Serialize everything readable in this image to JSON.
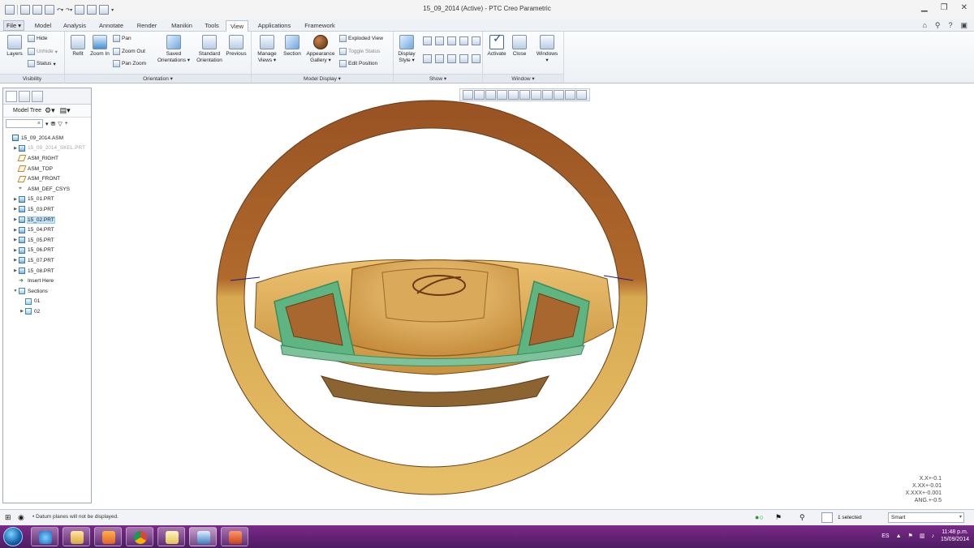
{
  "window": {
    "title": "15_09_2014 (Active) - PTC Creo Parametric"
  },
  "ribbon_tabs": [
    {
      "label": "File ▾"
    },
    {
      "label": "Model"
    },
    {
      "label": "Analysis"
    },
    {
      "label": "Annotate"
    },
    {
      "label": "Render"
    },
    {
      "label": "Manikin"
    },
    {
      "label": "Tools"
    },
    {
      "label": "View"
    },
    {
      "label": "Applications"
    },
    {
      "label": "Framework"
    }
  ],
  "groups": {
    "visibility": {
      "label": "Visibility",
      "layers": "Layers",
      "hide": "Hide",
      "unhide": "Unhide",
      "status": "Status"
    },
    "orientation": {
      "label": "Orientation ▾",
      "refit": "Refit",
      "zoom_in": "Zoom In",
      "pan": "Pan",
      "zoom_out": "Zoom Out",
      "pan_zoom": "Pan Zoom",
      "saved_orientations_1": "Saved",
      "saved_orientations_2": "Orientations ▾",
      "standard_orientation_1": "Standard",
      "standard_orientation_2": "Orientation",
      "previous": "Previous"
    },
    "model_display": {
      "label": "Model Display ▾",
      "manage_views_1": "Manage",
      "manage_views_2": "Views ▾",
      "section": "Section",
      "appearance_gallery_1": "Appearance",
      "appearance_gallery_2": "Gallery ▾",
      "exploded_view": "Exploded View",
      "toggle_status": "Toggle Status",
      "edit_position": "Edit Position"
    },
    "show": {
      "label": "Show ▾",
      "display_style_1": "Display",
      "display_style_2": "Style ▾"
    },
    "window": {
      "label": "Window ▾",
      "activate": "Activate",
      "close": "Close",
      "windows_1": "Windows",
      "windows_2": "▾"
    }
  },
  "model_tree": {
    "header": "Model Tree",
    "search_clear": "×",
    "items": [
      {
        "label": "15_09_2014.ASM",
        "icon": "asm",
        "indent": 0,
        "expander": ""
      },
      {
        "label": "15_09_2014_SKEL.PRT",
        "icon": "prt",
        "indent": 1,
        "expander": "▶",
        "ghost": true
      },
      {
        "label": "ASM_RIGHT",
        "icon": "plane",
        "indent": 1,
        "expander": ""
      },
      {
        "label": "ASM_TOP",
        "icon": "plane",
        "indent": 1,
        "expander": ""
      },
      {
        "label": "ASM_FRONT",
        "icon": "plane",
        "indent": 1,
        "expander": ""
      },
      {
        "label": "ASM_DEF_CSYS",
        "icon": "csys",
        "indent": 1,
        "expander": ""
      },
      {
        "label": "15_01.PRT",
        "icon": "prt",
        "indent": 1,
        "expander": "▶"
      },
      {
        "label": "15_03.PRT",
        "icon": "prt",
        "indent": 1,
        "expander": "▶"
      },
      {
        "label": "15_02.PRT",
        "icon": "prt",
        "indent": 1,
        "expander": "▶",
        "selected": true
      },
      {
        "label": "15_04.PRT",
        "icon": "prt",
        "indent": 1,
        "expander": "▶"
      },
      {
        "label": "15_05.PRT",
        "icon": "prt",
        "indent": 1,
        "expander": "▶"
      },
      {
        "label": "15_06.PRT",
        "icon": "prt",
        "indent": 1,
        "expander": "▶"
      },
      {
        "label": "15_07.PRT",
        "icon": "prt",
        "indent": 1,
        "expander": "▶"
      },
      {
        "label": "15_08.PRT",
        "icon": "prt",
        "indent": 1,
        "expander": "▶"
      },
      {
        "label": "Insert Here",
        "icon": "ins",
        "indent": 1,
        "expander": ""
      },
      {
        "label": "Sections",
        "icon": "sec",
        "indent": 1,
        "expander": "▼"
      },
      {
        "label": "01",
        "icon": "sec",
        "indent": 2,
        "expander": ""
      },
      {
        "label": "02",
        "icon": "sec",
        "indent": 2,
        "expander": "▶"
      }
    ]
  },
  "tolerances": [
    "X.X+-0.1",
    "X.XX+-0.01",
    "X.XXX+-0.001",
    "ANG.+-0.5"
  ],
  "status": {
    "message": "• Datum planes will not be displayed.",
    "selection": "1 selected",
    "filter": "Smart"
  },
  "taskbar": {
    "lang": "ES",
    "time": "11:48 p.m.",
    "date": "15/09/2014"
  },
  "colors": {
    "wheel_gold": "#d9a84a",
    "wheel_brown": "#8a4a1c",
    "highlight_green": "#5fb582",
    "taskbar": "#5f2273"
  }
}
